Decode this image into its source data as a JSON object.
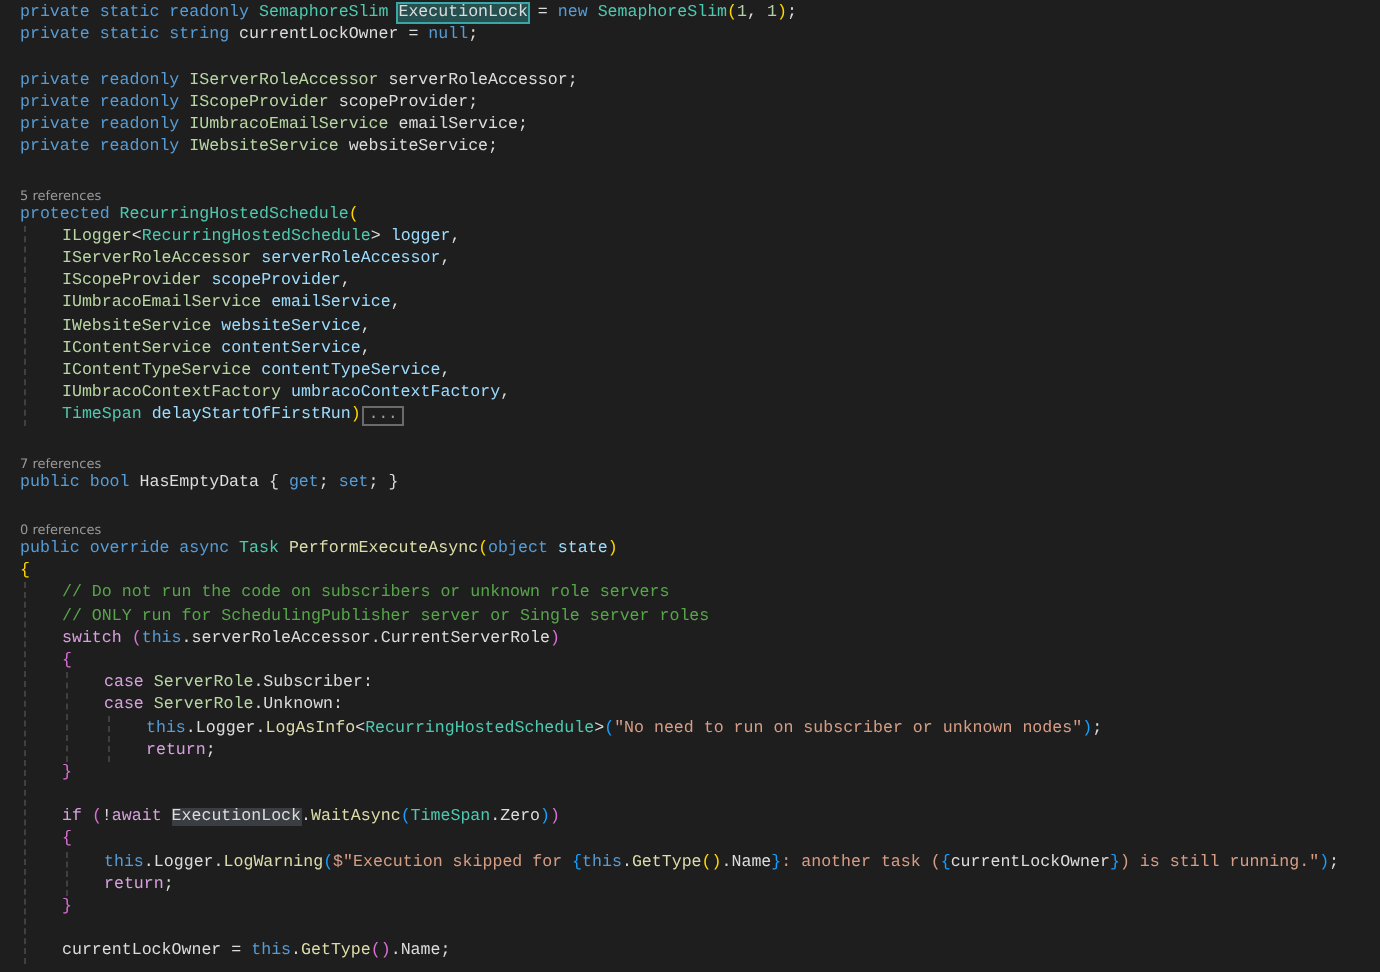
{
  "lines": [
    {
      "kind": "code",
      "tokens": [
        {
          "text": "private static readonly ",
          "kind": "keyword"
        },
        {
          "text": "SemaphoreSlim ",
          "kind": "type"
        },
        {
          "text": "ExecutionLock",
          "kind": "selection"
        },
        {
          "text": " = ",
          "kind": "plain"
        },
        {
          "text": "new ",
          "kind": "keyword"
        },
        {
          "text": "SemaphoreSlim",
          "kind": "type"
        },
        {
          "text": "(",
          "kind": "brace1"
        },
        {
          "text": "1",
          "kind": "number"
        },
        {
          "text": ", ",
          "kind": "plain"
        },
        {
          "text": "1",
          "kind": "number"
        },
        {
          "text": ")",
          "kind": "brace1"
        },
        {
          "text": ";",
          "kind": "plain"
        }
      ]
    },
    {
      "kind": "code",
      "tokens": [
        {
          "text": "private static string ",
          "kind": "keyword"
        },
        {
          "text": "currentLockOwner = ",
          "kind": "plain"
        },
        {
          "text": "null",
          "kind": "keyword"
        },
        {
          "text": ";",
          "kind": "plain"
        }
      ]
    },
    {
      "kind": "blank"
    },
    {
      "kind": "code",
      "tokens": [
        {
          "text": "private readonly ",
          "kind": "keyword"
        },
        {
          "text": "IServerRoleAccessor",
          "kind": "interface"
        },
        {
          "text": " serverRoleAccessor;",
          "kind": "plain"
        }
      ]
    },
    {
      "kind": "code",
      "tokens": [
        {
          "text": "private readonly ",
          "kind": "keyword"
        },
        {
          "text": "IScopeProvider",
          "kind": "interface"
        },
        {
          "text": " scopeProvider;",
          "kind": "plain"
        }
      ]
    },
    {
      "kind": "code",
      "tokens": [
        {
          "text": "private readonly ",
          "kind": "keyword"
        },
        {
          "text": "IUmbracoEmailService",
          "kind": "interface"
        },
        {
          "text": " emailService;",
          "kind": "plain"
        }
      ]
    },
    {
      "kind": "code",
      "tokens": [
        {
          "text": "private readonly ",
          "kind": "keyword"
        },
        {
          "text": "IWebsiteService",
          "kind": "interface"
        },
        {
          "text": " websiteService;",
          "kind": "plain"
        }
      ]
    },
    {
      "kind": "blank"
    },
    {
      "kind": "codelens",
      "text": "5 references"
    },
    {
      "kind": "code",
      "tokens": [
        {
          "text": "protected ",
          "kind": "keyword"
        },
        {
          "text": "RecurringHostedSchedule",
          "kind": "type"
        },
        {
          "text": "(",
          "kind": "brace1"
        }
      ],
      "children": [
        {
          "kind": "code",
          "tokens": [
            {
              "text": "ILogger",
              "kind": "interface"
            },
            {
              "text": "<",
              "kind": "plain"
            },
            {
              "text": "RecurringHostedSchedule",
              "kind": "type"
            },
            {
              "text": "> ",
              "kind": "plain"
            },
            {
              "text": "logger",
              "kind": "param"
            },
            {
              "text": ",",
              "kind": "plain"
            }
          ]
        },
        {
          "kind": "code",
          "tokens": [
            {
              "text": "IServerRoleAccessor ",
              "kind": "interface"
            },
            {
              "text": "serverRoleAccessor",
              "kind": "param"
            },
            {
              "text": ",",
              "kind": "plain"
            }
          ]
        },
        {
          "kind": "code",
          "tokens": [
            {
              "text": "IScopeProvider ",
              "kind": "interface"
            },
            {
              "text": "scopeProvider",
              "kind": "param"
            },
            {
              "text": ",",
              "kind": "plain"
            }
          ]
        },
        {
          "kind": "code",
          "tokens": [
            {
              "text": "IUmbracoEmailService ",
              "kind": "interface"
            },
            {
              "text": "emailService",
              "kind": "param"
            },
            {
              "text": ",",
              "kind": "plain"
            }
          ]
        },
        {
          "kind": "code",
          "tokens": [
            {
              "text": "IWebsiteService ",
              "kind": "interface"
            },
            {
              "text": "websiteService",
              "kind": "param"
            },
            {
              "text": ",",
              "kind": "plain"
            }
          ]
        },
        {
          "kind": "code",
          "tokens": [
            {
              "text": "IContentService ",
              "kind": "interface"
            },
            {
              "text": "contentService",
              "kind": "param"
            },
            {
              "text": ",",
              "kind": "plain"
            }
          ]
        },
        {
          "kind": "code",
          "tokens": [
            {
              "text": "IContentTypeService ",
              "kind": "interface"
            },
            {
              "text": "contentTypeService",
              "kind": "param"
            },
            {
              "text": ",",
              "kind": "plain"
            }
          ]
        },
        {
          "kind": "code",
          "tokens": [
            {
              "text": "IUmbracoContextFactory ",
              "kind": "interface"
            },
            {
              "text": "umbracoContextFactory",
              "kind": "param"
            },
            {
              "text": ",",
              "kind": "plain"
            }
          ]
        },
        {
          "kind": "code",
          "tokens": [
            {
              "text": "TimeSpan ",
              "kind": "type"
            },
            {
              "text": "delayStartOfFirstRun",
              "kind": "param"
            },
            {
              "text": ")",
              "kind": "brace1"
            }
          ],
          "fold": {
            "label": "..."
          }
        }
      ]
    },
    {
      "kind": "blank"
    },
    {
      "kind": "codelens",
      "text": "7 references"
    },
    {
      "kind": "code",
      "tokens": [
        {
          "text": "public bool ",
          "kind": "keyword"
        },
        {
          "text": "HasEmptyData { ",
          "kind": "plain"
        },
        {
          "text": "get",
          "kind": "keyword"
        },
        {
          "text": "; ",
          "kind": "plain"
        },
        {
          "text": "set",
          "kind": "keyword"
        },
        {
          "text": "; }",
          "kind": "plain"
        }
      ]
    },
    {
      "kind": "blank"
    },
    {
      "kind": "codelens",
      "text": "0 references"
    },
    {
      "kind": "code",
      "tokens": [
        {
          "text": "public override async ",
          "kind": "keyword"
        },
        {
          "text": "Task ",
          "kind": "type"
        },
        {
          "text": "PerformExecuteAsync",
          "kind": "method"
        },
        {
          "text": "(",
          "kind": "brace1"
        },
        {
          "text": "object ",
          "kind": "keyword"
        },
        {
          "text": "state",
          "kind": "param"
        },
        {
          "text": ")",
          "kind": "brace1"
        }
      ]
    },
    {
      "kind": "code",
      "tokens": [
        {
          "text": "{",
          "kind": "brace1"
        }
      ],
      "children": [
        {
          "kind": "code",
          "tokens": [
            {
              "text": "// Do not run the code on subscribers or unknown role servers",
              "kind": "comment"
            }
          ]
        },
        {
          "kind": "code",
          "tokens": [
            {
              "text": "// ONLY run for SchedulingPublisher server or Single server roles",
              "kind": "comment"
            }
          ]
        },
        {
          "kind": "code",
          "tokens": [
            {
              "text": "switch ",
              "kind": "control"
            },
            {
              "text": "(",
              "kind": "brace2"
            },
            {
              "text": "this",
              "kind": "keyword"
            },
            {
              "text": ".serverRoleAccessor.CurrentServerRole",
              "kind": "plain"
            },
            {
              "text": ")",
              "kind": "brace2"
            }
          ]
        },
        {
          "kind": "code",
          "tokens": [
            {
              "text": "{",
              "kind": "brace2"
            }
          ],
          "children": [
            {
              "kind": "code",
              "tokens": [
                {
                  "text": "case ",
                  "kind": "control"
                },
                {
                  "text": "ServerRole",
                  "kind": "interface"
                },
                {
                  "text": ".Subscriber:",
                  "kind": "plain"
                }
              ]
            },
            {
              "kind": "code",
              "tokens": [
                {
                  "text": "case ",
                  "kind": "control"
                },
                {
                  "text": "ServerRole",
                  "kind": "interface"
                },
                {
                  "text": ".Unknown:",
                  "kind": "plain"
                }
              ],
              "children": [
                {
                  "kind": "code",
                  "tokens": [
                    {
                      "text": "this",
                      "kind": "keyword"
                    },
                    {
                      "text": ".Logger.",
                      "kind": "plain"
                    },
                    {
                      "text": "LogAsInfo",
                      "kind": "method"
                    },
                    {
                      "text": "<",
                      "kind": "plain"
                    },
                    {
                      "text": "RecurringHostedSchedule",
                      "kind": "type"
                    },
                    {
                      "text": ">",
                      "kind": "plain"
                    },
                    {
                      "text": "(",
                      "kind": "brace3"
                    },
                    {
                      "text": "\"No need to run on subscriber or unknown nodes\"",
                      "kind": "string"
                    },
                    {
                      "text": ")",
                      "kind": "brace3"
                    },
                    {
                      "text": ";",
                      "kind": "plain"
                    }
                  ]
                },
                {
                  "kind": "code",
                  "tokens": [
                    {
                      "text": "return",
                      "kind": "control"
                    },
                    {
                      "text": ";",
                      "kind": "plain"
                    }
                  ]
                }
              ]
            }
          ]
        },
        {
          "kind": "code",
          "tokens": [
            {
              "text": "}",
              "kind": "brace2"
            }
          ]
        },
        {
          "kind": "blank"
        },
        {
          "kind": "code",
          "tokens": [
            {
              "text": "if ",
              "kind": "control"
            },
            {
              "text": "(",
              "kind": "brace2"
            },
            {
              "text": "!",
              "kind": "plain"
            },
            {
              "text": "await ",
              "kind": "control"
            },
            {
              "text": "ExecutionLock",
              "kind": "reference"
            },
            {
              "text": ".",
              "kind": "plain"
            },
            {
              "text": "WaitAsync",
              "kind": "method"
            },
            {
              "text": "(",
              "kind": "brace3"
            },
            {
              "text": "TimeSpan",
              "kind": "type"
            },
            {
              "text": ".Zero",
              "kind": "plain"
            },
            {
              "text": ")",
              "kind": "brace3"
            },
            {
              "text": ")",
              "kind": "brace2"
            }
          ]
        },
        {
          "kind": "code",
          "tokens": [
            {
              "text": "{",
              "kind": "brace2"
            }
          ],
          "children": [
            {
              "kind": "code",
              "tokens": [
                {
                  "text": "this",
                  "kind": "keyword"
                },
                {
                  "text": ".Logger.",
                  "kind": "plain"
                },
                {
                  "text": "LogWarning",
                  "kind": "method"
                },
                {
                  "text": "(",
                  "kind": "brace3"
                },
                {
                  "text": "$\"Execution skipped for ",
                  "kind": "string"
                },
                {
                  "text": "{",
                  "kind": "brace3"
                },
                {
                  "text": "this",
                  "kind": "keyword"
                },
                {
                  "text": ".",
                  "kind": "plain"
                },
                {
                  "text": "GetType",
                  "kind": "method"
                },
                {
                  "text": "()",
                  "kind": "brace1"
                },
                {
                  "text": ".Name",
                  "kind": "plain"
                },
                {
                  "text": "}",
                  "kind": "brace3"
                },
                {
                  "text": ": another task (",
                  "kind": "string"
                },
                {
                  "text": "{",
                  "kind": "brace3"
                },
                {
                  "text": "currentLockOwner",
                  "kind": "plain"
                },
                {
                  "text": "}",
                  "kind": "brace3"
                },
                {
                  "text": ") is still running.\"",
                  "kind": "string"
                },
                {
                  "text": ")",
                  "kind": "brace3"
                },
                {
                  "text": ";",
                  "kind": "plain"
                }
              ]
            },
            {
              "kind": "code",
              "tokens": [
                {
                  "text": "return",
                  "kind": "control"
                },
                {
                  "text": ";",
                  "kind": "plain"
                }
              ]
            }
          ]
        },
        {
          "kind": "code",
          "tokens": [
            {
              "text": "}",
              "kind": "brace2"
            }
          ]
        },
        {
          "kind": "blank"
        },
        {
          "kind": "code",
          "tokens": [
            {
              "text": "currentLockOwner = ",
              "kind": "plain"
            },
            {
              "text": "this",
              "kind": "keyword"
            },
            {
              "text": ".",
              "kind": "plain"
            },
            {
              "text": "GetType",
              "kind": "method"
            },
            {
              "text": "()",
              "kind": "brace2"
            },
            {
              "text": ".Name;",
              "kind": "plain"
            }
          ]
        }
      ]
    }
  ]
}
